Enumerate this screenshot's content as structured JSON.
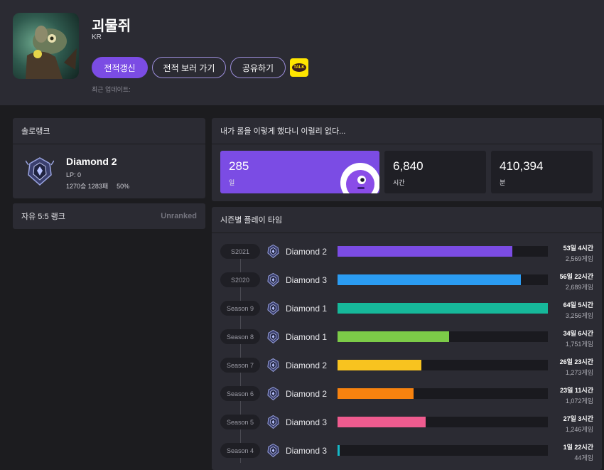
{
  "profile": {
    "name": "괴물쥐",
    "region": "KR",
    "refresh_label": "전적갱신",
    "view_history_label": "전적 보러 가기",
    "share_label": "공유하기",
    "kakao_label": "TALK",
    "updated_label": "최근 업데이트:"
  },
  "solo": {
    "title": "솔로랭크",
    "tier": "Diamond 2",
    "lp": "LP: 0",
    "record": "1270승 1283패",
    "winrate": "50%"
  },
  "flex": {
    "title": "자유 5:5 랭크",
    "value": "Unranked"
  },
  "playtime": {
    "title": "내가 롤을 이렇게 했다니 이럴리 없다...",
    "stats": [
      {
        "value": "285",
        "unit": "일"
      },
      {
        "value": "6,840",
        "unit": "시간"
      },
      {
        "value": "410,394",
        "unit": "분"
      }
    ]
  },
  "season_playtime": {
    "title": "시즌별 플레이 타임",
    "rows": [
      {
        "season": "S2021",
        "tier": "Diamond 2",
        "time": "53일 4시간",
        "games": "2,569게임",
        "fraction": 0.83,
        "color": "#7b4ce4"
      },
      {
        "season": "S2020",
        "tier": "Diamond 3",
        "time": "56일 22시간",
        "games": "2,689게임",
        "fraction": 0.87,
        "color": "#2b9cf2"
      },
      {
        "season": "Season 9",
        "tier": "Diamond 1",
        "time": "64일 5시간",
        "games": "3,256게임",
        "fraction": 1.0,
        "color": "#16b89a"
      },
      {
        "season": "Season 8",
        "tier": "Diamond 1",
        "time": "34일 6시간",
        "games": "1,751게임",
        "fraction": 0.53,
        "color": "#7ccb48"
      },
      {
        "season": "Season 7",
        "tier": "Diamond 2",
        "time": "26일 23시간",
        "games": "1,273게임",
        "fraction": 0.4,
        "color": "#f8c31f"
      },
      {
        "season": "Season 6",
        "tier": "Diamond 2",
        "time": "23일 11시간",
        "games": "1,072게임",
        "fraction": 0.36,
        "color": "#f7820f"
      },
      {
        "season": "Season 5",
        "tier": "Diamond 3",
        "time": "27일 3시간",
        "games": "1,246게임",
        "fraction": 0.42,
        "color": "#ef5b8f"
      },
      {
        "season": "Season 4",
        "tier": "Diamond 3",
        "time": "1일 22시간",
        "games": "44게임",
        "fraction": 0.01,
        "color": "#16b8c8"
      }
    ]
  }
}
